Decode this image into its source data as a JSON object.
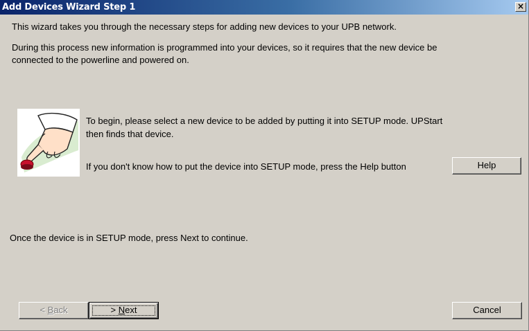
{
  "window": {
    "title": "Add Devices Wizard Step 1",
    "close_glyph": "×"
  },
  "intro": {
    "line1": "This wizard takes you through the necessary steps for adding new devices to your UPB network.",
    "line2a": "During this process new information is programmed into your devices, so it requires that the new device be",
    "line2b": "connected to the powerline and powered on."
  },
  "setup": {
    "line1a": "To begin, please select a new device to be added by putting it into SETUP mode.  UPStart",
    "line1b": "then finds that device.",
    "help_text": "If you don't know how to put the device into SETUP mode, press the Help button",
    "help_button": "Help"
  },
  "footer_text": "Once the device is in SETUP mode, press Next to continue.",
  "buttons": {
    "back_prefix": "< ",
    "back_mnemonic": "B",
    "back_rest": "ack",
    "next_prefix": "> ",
    "next_mnemonic": "N",
    "next_rest": "ext",
    "cancel": "Cancel"
  },
  "colors": {
    "title_start": "#0a246a",
    "title_end": "#a6caf0",
    "dialog_face": "#d4d0c8",
    "button_red": "#c8102e"
  },
  "icons": {
    "hand": "pointing-hand-pressing-button-icon",
    "close": "close-icon"
  }
}
